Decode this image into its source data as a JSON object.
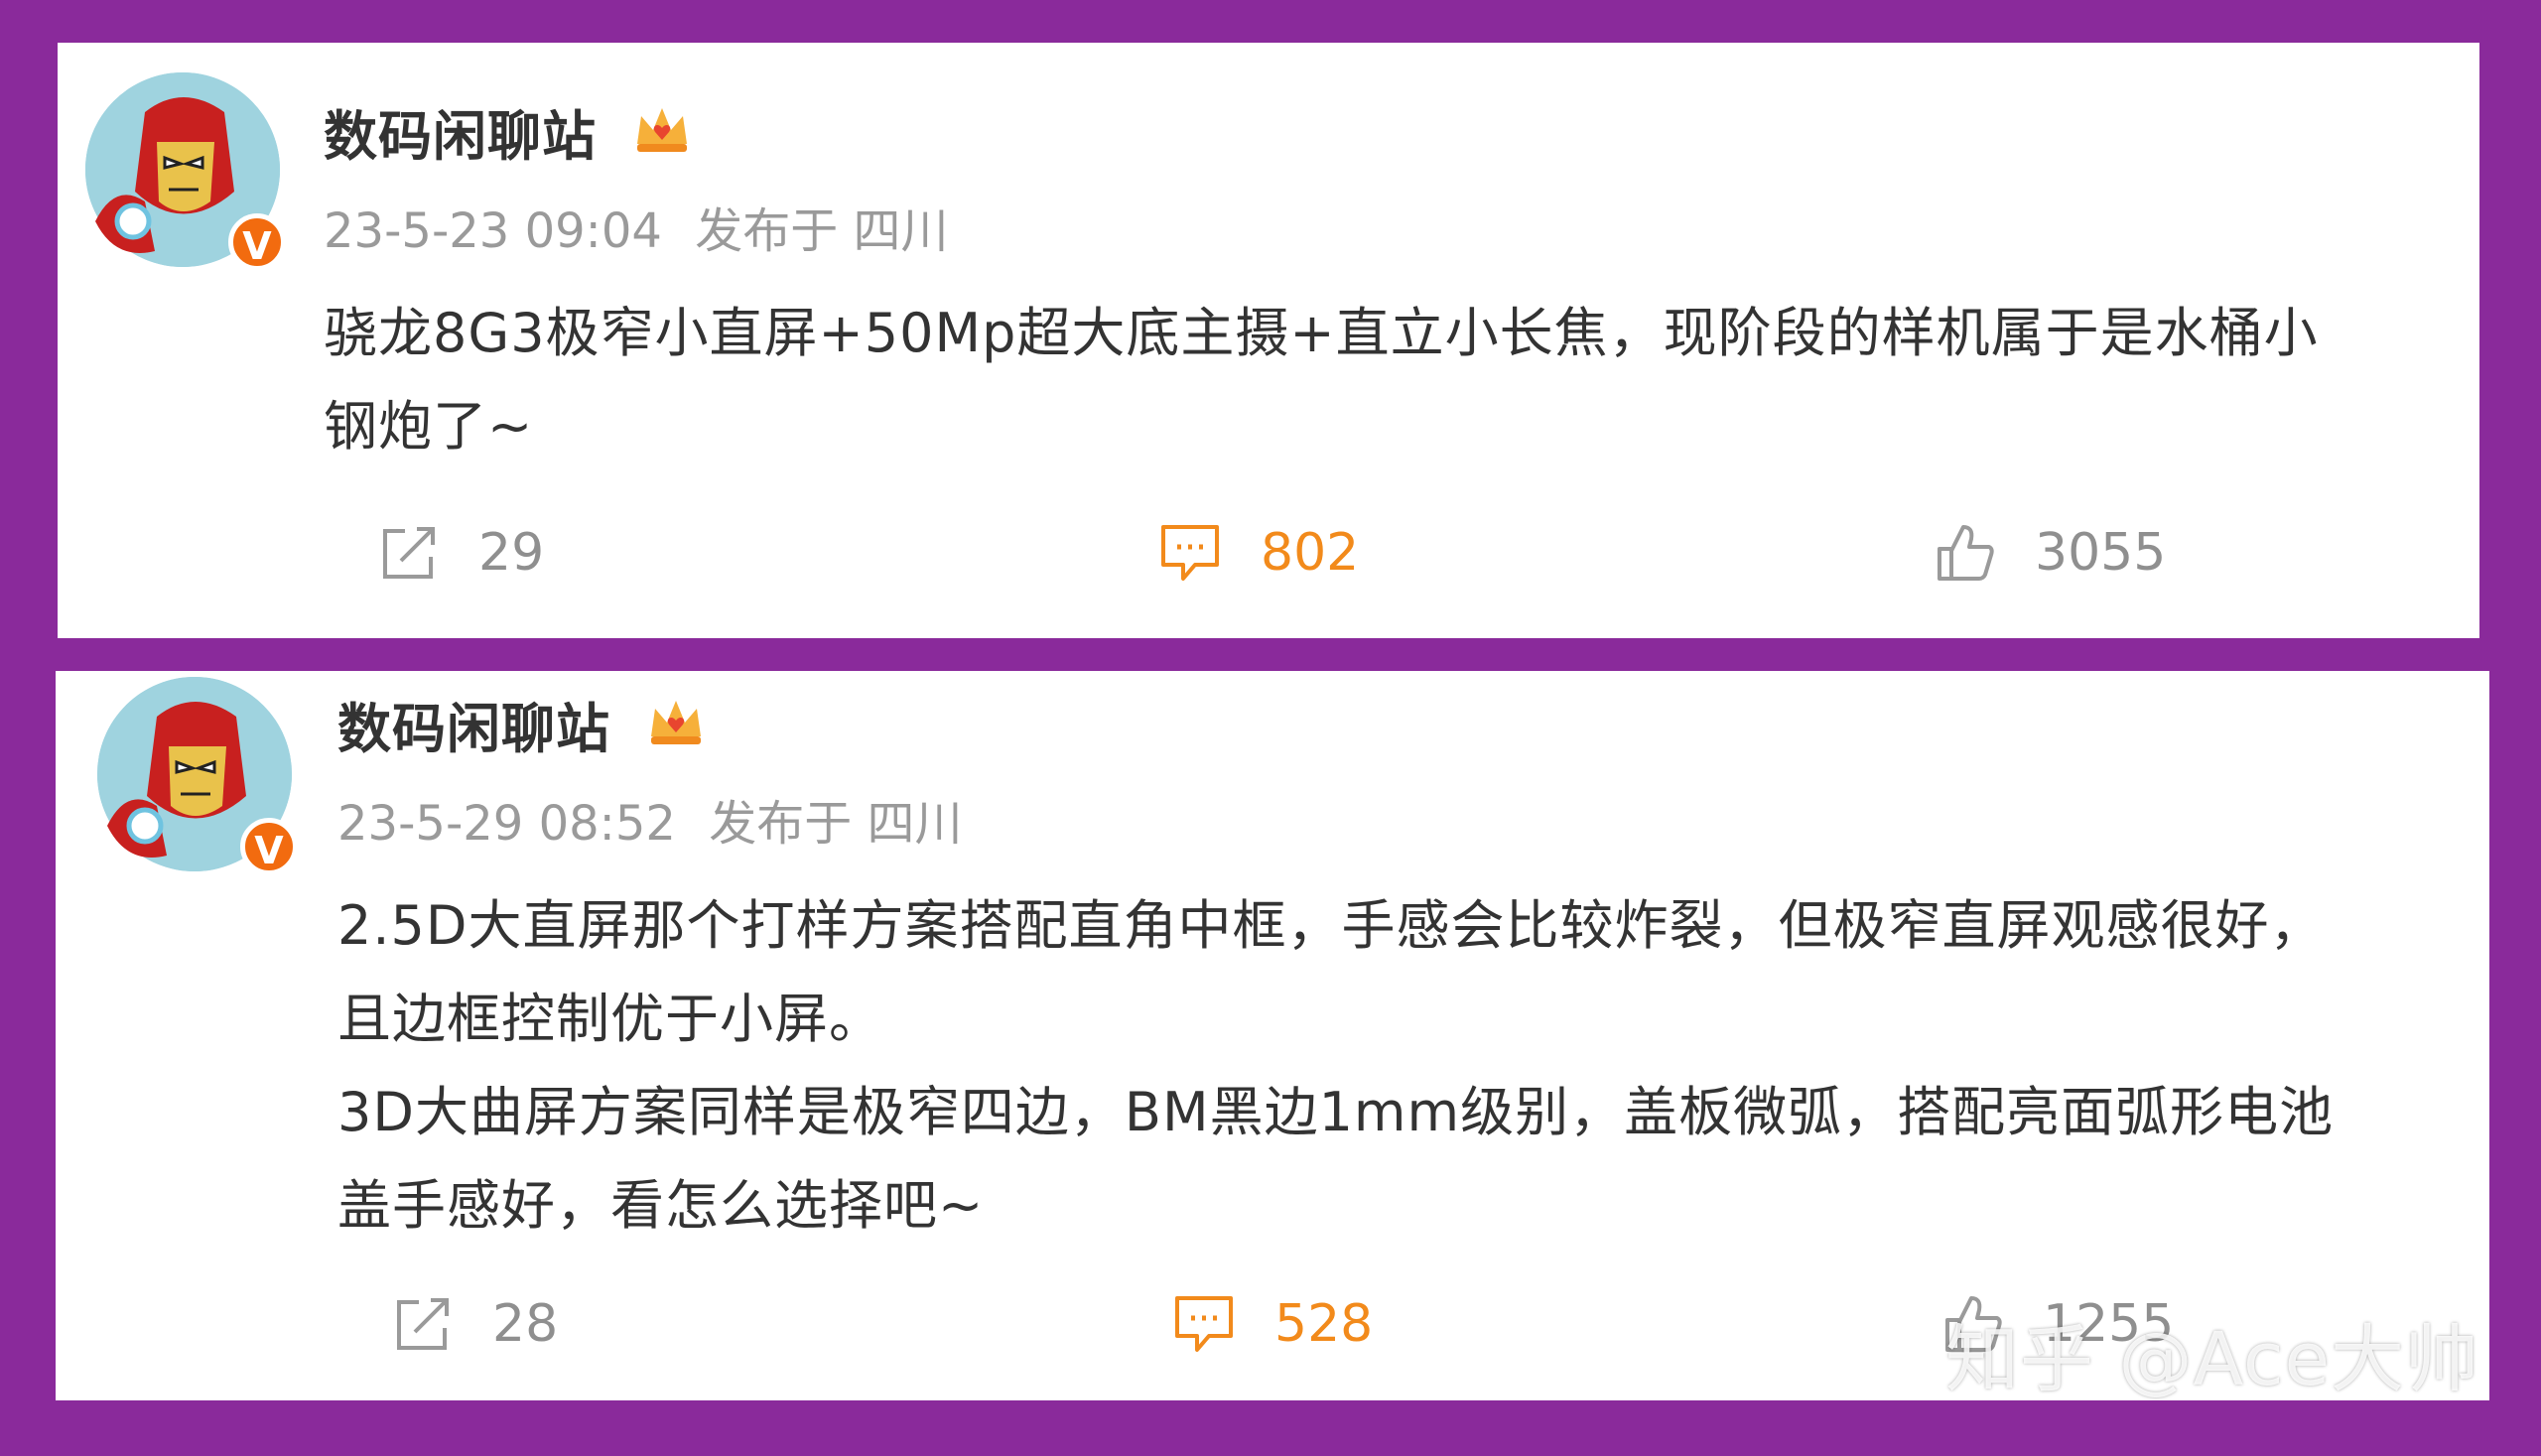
{
  "posts": [
    {
      "author": "数码闲聊站",
      "verified_badge": "V",
      "timestamp": "23-5-23 09:04",
      "location": "发布于 四川",
      "content_lines": [
        "骁龙8G3极窄小直屏+50Mp超大底主摄+直立小长焦，现阶段的样机属于是水桶小",
        "钢炮了~"
      ],
      "actions": {
        "share": {
          "icon": "share-icon",
          "count": "29"
        },
        "comment": {
          "icon": "comment-icon",
          "count": "802"
        },
        "like": {
          "icon": "like-icon",
          "count": "3055"
        }
      }
    },
    {
      "author": "数码闲聊站",
      "verified_badge": "V",
      "timestamp": "23-5-29 08:52",
      "location": "发布于 四川",
      "content_lines": [
        "2.5D大直屏那个打样方案搭配直角中框，手感会比较炸裂，但极窄直屏观感很好，",
        "且边框控制优于小屏。",
        "3D大曲屏方案同样是极窄四边，BM黑边1mm级别，盖板微弧，搭配亮面弧形电池",
        "盖手感好，看怎么选择吧~"
      ],
      "actions": {
        "share": {
          "icon": "share-icon",
          "count": "28"
        },
        "comment": {
          "icon": "comment-icon",
          "count": "528"
        },
        "like": {
          "icon": "like-icon",
          "count": "1255"
        }
      }
    }
  ],
  "watermark": "知乎 @Ace大帅",
  "colors": {
    "background": "#8a2a9b",
    "card": "#ffffff",
    "accent_orange": "#f28a1b",
    "meta_gray": "#9a9a9a"
  }
}
